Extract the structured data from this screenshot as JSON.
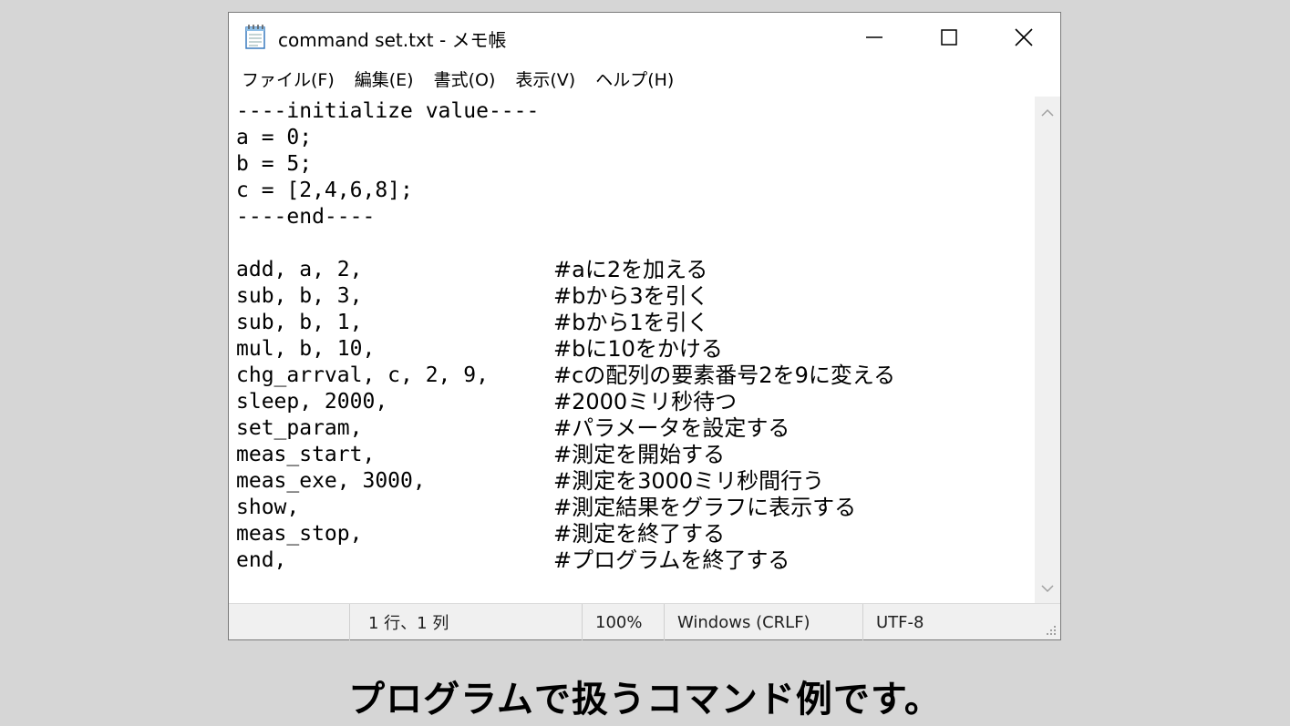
{
  "window": {
    "title": "command set.txt - メモ帳",
    "icon": "notepad-icon",
    "controls": [
      "minimize-icon",
      "maximize-icon",
      "close-icon"
    ]
  },
  "menu": [
    "ファイル(F)",
    "編集(E)",
    "書式(O)",
    "表示(V)",
    "ヘルプ(H)"
  ],
  "editor": {
    "lines": [
      {
        "cmd": "----initialize value----",
        "comment": ""
      },
      {
        "cmd": "a = 0;",
        "comment": ""
      },
      {
        "cmd": "b = 5;",
        "comment": ""
      },
      {
        "cmd": "c = [2,4,6,8];",
        "comment": ""
      },
      {
        "cmd": "----end----",
        "comment": ""
      },
      {
        "cmd": "",
        "comment": ""
      },
      {
        "cmd": "add, a, 2,",
        "comment": "#aに2を加える"
      },
      {
        "cmd": "sub, b, 3,",
        "comment": "#bから3を引く"
      },
      {
        "cmd": "sub, b, 1,",
        "comment": "#bから1を引く"
      },
      {
        "cmd": "mul, b, 10,",
        "comment": "#bに10をかける"
      },
      {
        "cmd": "chg_arrval, c, 2, 9,",
        "comment": "#cの配列の要素番号2を9に変える"
      },
      {
        "cmd": "sleep, 2000,",
        "comment": "#2000ミリ秒待つ"
      },
      {
        "cmd": "set_param,",
        "comment": "#パラメータを設定する"
      },
      {
        "cmd": "meas_start,",
        "comment": "#測定を開始する"
      },
      {
        "cmd": "meas_exe, 3000,",
        "comment": "#測定を3000ミリ秒間行う"
      },
      {
        "cmd": "show,",
        "comment": "#測定結果をグラフに表示する"
      },
      {
        "cmd": "meas_stop,",
        "comment": "#測定を終了する"
      },
      {
        "cmd": "end,",
        "comment": "#プログラムを終了する"
      }
    ]
  },
  "status": {
    "position": "1 行、1 列",
    "zoom": "100%",
    "line_ending": "Windows (CRLF)",
    "encoding": "UTF-8"
  },
  "caption": "プログラムで扱うコマンド例です。"
}
